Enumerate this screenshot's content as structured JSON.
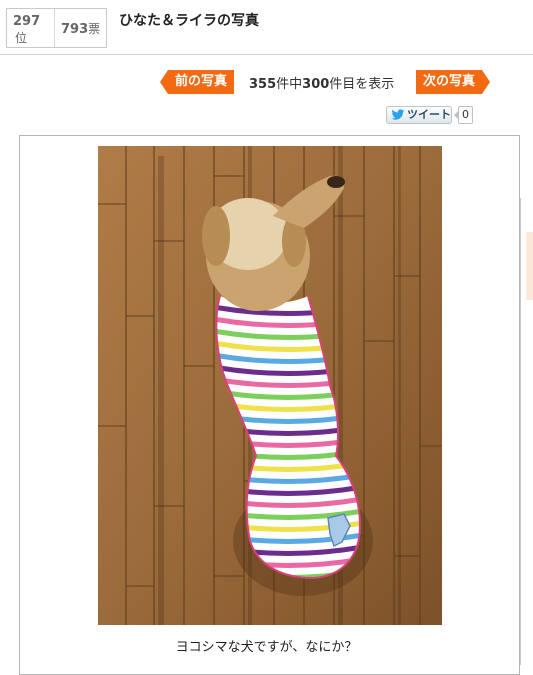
{
  "header": {
    "rank_number": "297",
    "rank_unit": "位",
    "votes_number": "793",
    "votes_unit": "票",
    "title": "ひなた＆ライラの写真"
  },
  "nav": {
    "prev_label": "前の写真",
    "next_label": "次の写真",
    "current_index": "355",
    "count_mid": "件中",
    "total": "300",
    "count_suffix": "件目を表示"
  },
  "tweet": {
    "label": "ツイート",
    "count": "0"
  },
  "photo": {
    "caption": "ヨコシマな犬ですが、なにか？"
  },
  "colors": {
    "accent": "#f26a12",
    "floor_base": "#9b6b3a",
    "floor_dark": "#6e4722"
  },
  "icons": {
    "tweet": "twitter-bird-icon"
  }
}
